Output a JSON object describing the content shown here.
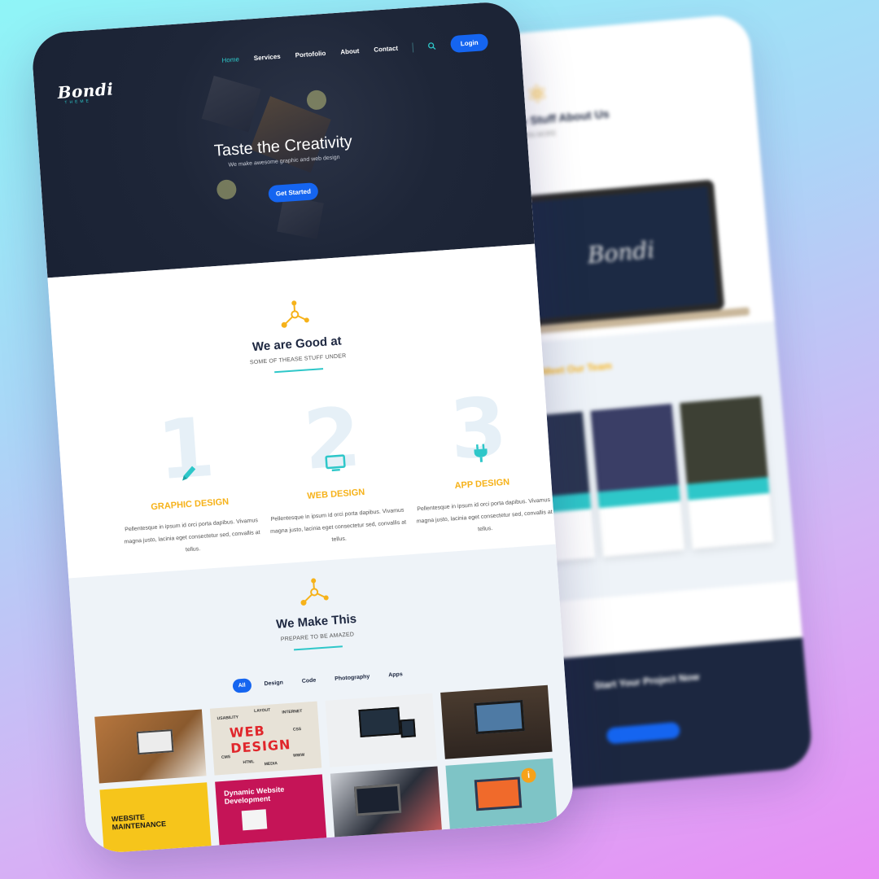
{
  "brand": {
    "logo_text": "Bondi",
    "logo_sub": "THEME"
  },
  "nav": {
    "items": [
      "Home",
      "Services",
      "Portofolio",
      "About",
      "Contact"
    ],
    "active": "Home",
    "login_label": "Login",
    "search_icon": "search-icon"
  },
  "hero": {
    "title": "Taste the Creativity",
    "subtitle": "We make awesome graphic and web design",
    "cta_label": "Get Started"
  },
  "good_at": {
    "icon": "share-icon",
    "title": "We are Good at",
    "subtitle": "SOME OF THEASE STUFF UNDER",
    "services": [
      {
        "number": "1",
        "icon": "pencil-icon",
        "title": "GRAPHIC DESIGN",
        "text": "Pellentesque in ipsum id orci porta dapibus. Vivamus magna justo, lacinia eget consectetur sed, convallis at tellus."
      },
      {
        "number": "2",
        "icon": "monitor-icon",
        "title": "WEB DESIGN",
        "text": "Pellentesque in ipsum id orci porta dapibus. Vivamus magna justo, lacinia eget consectetur sed, convallis at tellus."
      },
      {
        "number": "3",
        "icon": "plug-icon",
        "title": "APP DESIGN",
        "text": "Pellentesque in ipsum id orci porta dapibus. Vivamus magna justo, lacinia eget consectetur sed, convallis at tellus."
      }
    ]
  },
  "make_this": {
    "icon": "share-icon",
    "title": "We Make This",
    "subtitle": "PREPARE TO BE AMAZED",
    "filters": [
      "All",
      "Design",
      "Code",
      "Photography",
      "Apps"
    ],
    "active_filter": "All",
    "gallery": {
      "web_design_caption": "WEB DESIGN",
      "web_design_labels": [
        "USABILITY",
        "LAYOUT",
        "INTERNET",
        "CSS",
        "CMS",
        "HTML",
        "MEDIA",
        "WWW"
      ],
      "maintenance_caption_1": "WEBSITE",
      "maintenance_caption_2": "MAINTENANCE",
      "dynamic_caption": "Dynamic Website Development"
    }
  },
  "back_page": {
    "about_title": "Some Stuff About Us",
    "about_sub": "LEARN MORE",
    "team_title": "Meet Our Team",
    "cta_title": "Start Your Project Now"
  },
  "colors": {
    "accent": "#2ec7c9",
    "primary": "#1565f0",
    "highlight": "#f6b21a",
    "hero_bg": "#1e2638"
  }
}
